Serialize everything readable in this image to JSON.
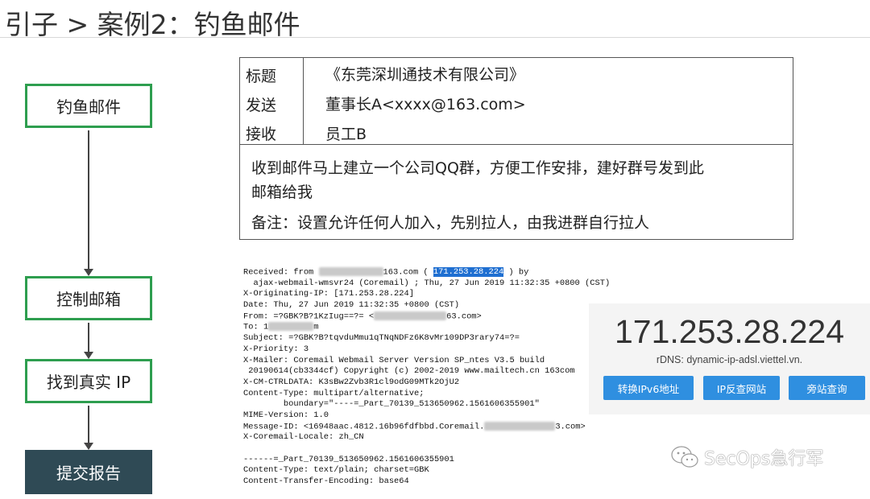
{
  "slide": {
    "title": "引子 > 案例2：钓鱼邮件"
  },
  "flow": {
    "steps": [
      "钓鱼邮件",
      "控制邮箱",
      "找到真实 IP",
      "提交报告"
    ],
    "accent_color": "#2e9e4f",
    "final_step_color": "#2f4a55"
  },
  "email": {
    "subject_label": "标题",
    "subject_value": "《东莞深圳通技术有限公司》",
    "from_label": "发送",
    "from_value": "董事长A<xxxx@163.com>",
    "to_label": "接收",
    "to_value": "员工B",
    "body_line_1": "收到邮件马上建立一个公司QQ群，方便工作安排，建好群号发到此",
    "body_line_2": "邮箱给我",
    "note": "备注：设置允许任何人加入，先别拉人，由我进群自行拉人"
  },
  "headers": {
    "l1a": "Received: from ",
    "l1b": "163.com ( ",
    "l1ip": "171.253.28.224",
    "l1c": " ) by",
    "l2": "  ajax-webmail-wmsvr24 (Coremail) ; Thu, 27 Jun 2019 11:32:35 +0800 (CST)",
    "l3": "X-Originating-IP: [171.253.28.224]",
    "l4": "Date: Thu, 27 Jun 2019 11:32:35 +0800 (CST)",
    "l5a": "From: =?GBK?B?1KzIug==?= <",
    "l5b": "63.com>",
    "l6a": "To: 1",
    "l6b": "m",
    "l7": "Subject: =?GBK?B?tqvduMmu1qTNqNDFz6K8vMr109DP3rary74=?=",
    "l8": "X-Priority: 3",
    "l9": "X-Mailer: Coremail Webmail Server Version SP_ntes V3.5 build",
    "l10": " 20190614(cb3344cf) Copyright (c) 2002-2019 www.mailtech.cn 163com",
    "l11": "X-CM-CTRLDATA: K3sBw2Zvb3R1cl9odG09MTk2OjU2",
    "l12": "Content-Type: multipart/alternative;",
    "l13": "        boundary=\"----=_Part_70139_513650962.1561606355901\"",
    "l14": "MIME-Version: 1.0",
    "l15a": "Message-ID: <16948aac.4812.16b96fdfbbd.Coremail.",
    "l15b": "3.com>",
    "l16": "X-Coremail-Locale: zh_CN",
    "l17": "",
    "l18": "------=_Part_70139_513650962.1561606355901",
    "l19": "Content-Type: text/plain; charset=GBK",
    "l20": "Content-Transfer-Encoding: base64"
  },
  "ip_lookup": {
    "ip": "171.253.28.224",
    "rdns": "rDNS: dynamic-ip-adsl.viettel.vn.",
    "buttons": [
      "转换IPv6地址",
      "IP反查网站",
      "旁站查询"
    ],
    "button_color": "#2f8fe0"
  },
  "watermark": {
    "text": "SecOps急行军",
    "icon": "wechat-icon"
  }
}
